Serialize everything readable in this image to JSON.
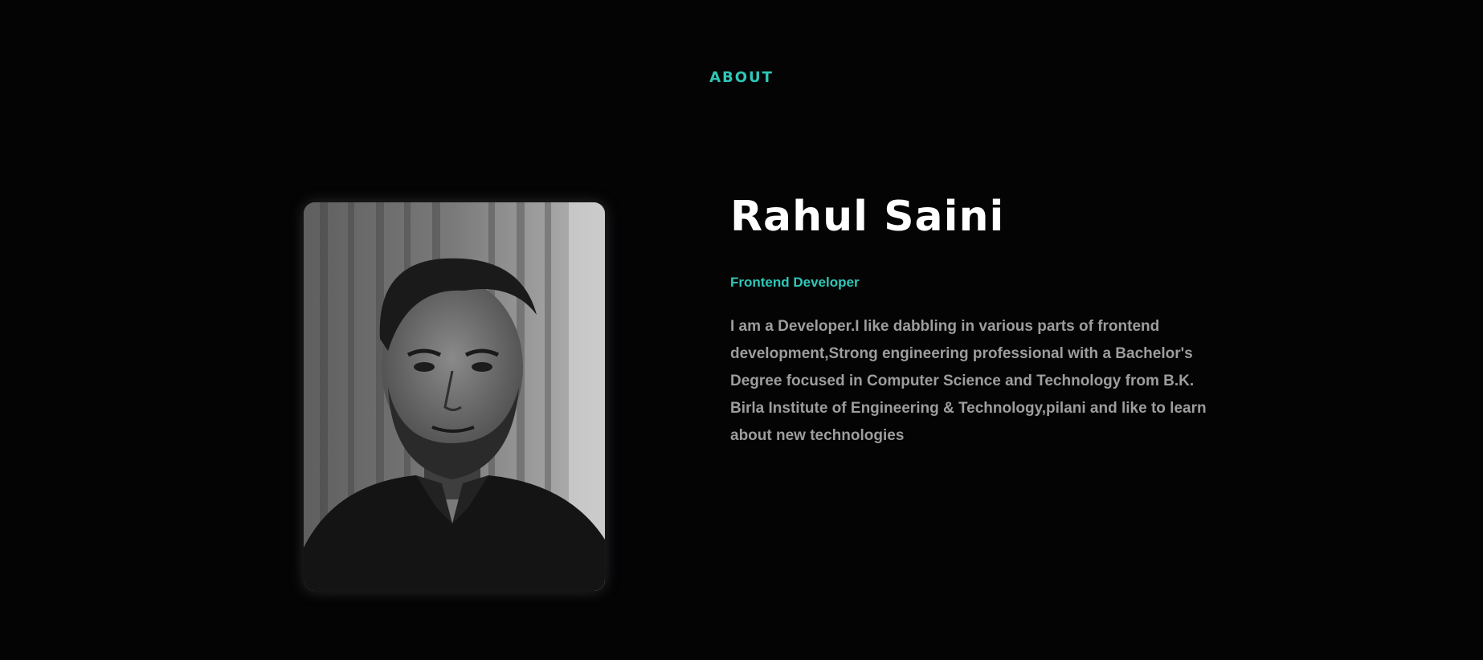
{
  "about": {
    "heading": "ABOUT"
  },
  "profile": {
    "name": "Rahul Saini",
    "role": "Frontend Developer",
    "bio": "I am a Developer.I like dabbling in various parts of frontend development,Strong engineering professional with a Bachelor's Degree focused in Computer Science and Technology from B.K. Birla Institute of Engineering & Technology,pilani and like to learn about new technologies",
    "photo_style": "grayscale"
  },
  "colors": {
    "background": "#040405",
    "accent": "#2fc7b7",
    "heading_text": "#ffffff",
    "body_text": "#9d9d9d"
  }
}
